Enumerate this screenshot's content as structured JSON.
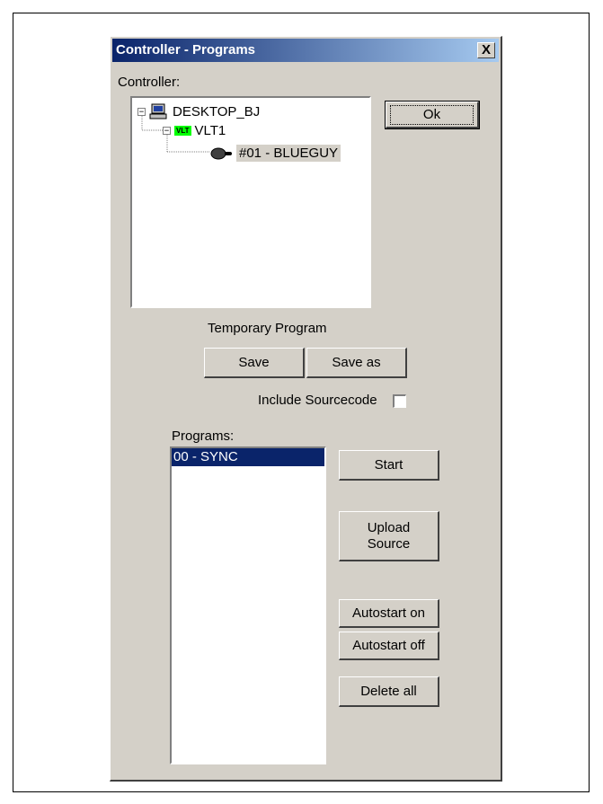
{
  "dialog": {
    "title": "Controller - Programs",
    "close_label": "X"
  },
  "controller": {
    "label": "Controller:",
    "tree": {
      "root": "DESKTOP_BJ",
      "child": "VLT1",
      "child_badge": "VLT",
      "leaf": "#01 - BLUEGUY"
    }
  },
  "ok_button": "Ok",
  "temporary_program": {
    "label": "Temporary Program",
    "save": "Save",
    "save_as": "Save as",
    "include_sourcecode": "Include Sourcecode",
    "include_sourcecode_checked": false
  },
  "programs": {
    "label": "Programs:",
    "items": [
      "00 - SYNC"
    ],
    "selected_index": 0
  },
  "buttons": {
    "start": "Start",
    "upload_source_line1": "Upload",
    "upload_source_line2": "Source",
    "autostart_on": "Autostart on",
    "autostart_off": "Autostart off",
    "delete_all": "Delete all"
  },
  "colors": {
    "dialog_bg": "#d4d0c8",
    "titlebar": "#0a246a",
    "vlt_badge": "#00ff00",
    "selection": "#0a246a"
  }
}
